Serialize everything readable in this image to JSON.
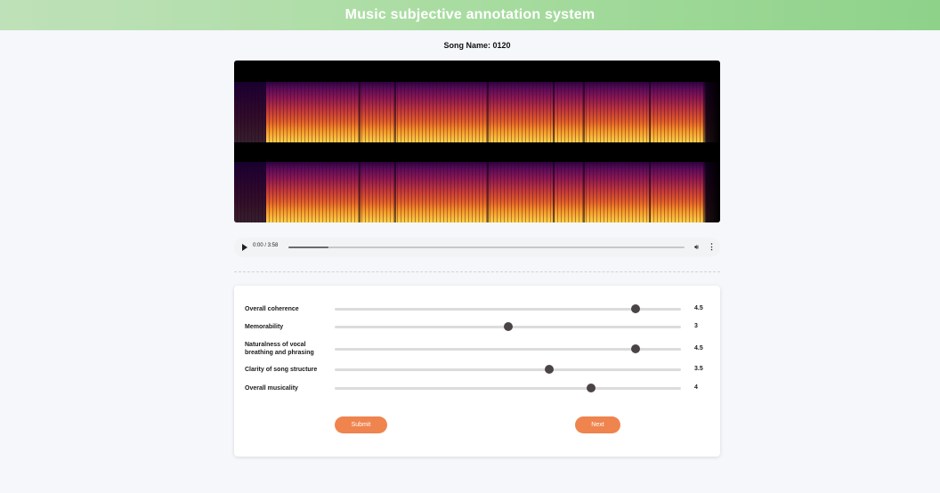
{
  "header": {
    "title": "Music subjective annotation system",
    "gradient_start": "#bfe1b9",
    "gradient_end": "#8ed28a"
  },
  "song": {
    "label": "Song Name: 0120"
  },
  "audio": {
    "time": "0:00 / 3:58",
    "buffered_fraction": 0.1,
    "play_icon": "play-icon",
    "volume_icon": "volume-icon",
    "more_icon": "more-options-icon"
  },
  "ratings": {
    "min": 0,
    "max": 5,
    "items": [
      {
        "label": "Overall coherence",
        "value": "4.5",
        "fraction": 0.87
      },
      {
        "label": "Memorability",
        "value": "3",
        "fraction": 0.5
      },
      {
        "label": "Naturalness of vocal breathing and phrasing",
        "value": "4.5",
        "fraction": 0.87
      },
      {
        "label": "Clarity of song structure",
        "value": "3.5",
        "fraction": 0.62
      },
      {
        "label": "Overall musicality",
        "value": "4",
        "fraction": 0.74
      }
    ]
  },
  "buttons": {
    "submit": "Submit",
    "next": "Next",
    "accent": "#ef844e"
  }
}
